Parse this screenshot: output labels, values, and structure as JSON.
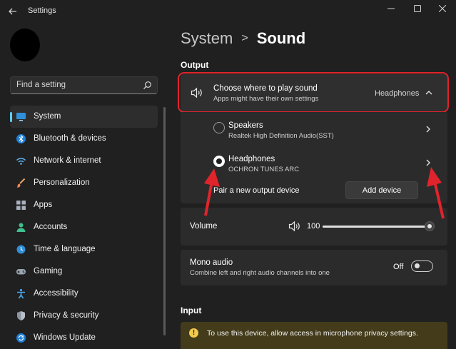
{
  "window": {
    "app_title": "Settings",
    "back_icon": "back-arrow-icon",
    "controls": [
      "minimize-icon",
      "maximize-icon",
      "close-icon"
    ]
  },
  "search": {
    "placeholder": "Find a setting",
    "icon": "search-icon"
  },
  "sidebar": {
    "items": [
      {
        "label": "System",
        "icon": "monitor-icon",
        "active": true
      },
      {
        "label": "Bluetooth & devices",
        "icon": "bluetooth-icon"
      },
      {
        "label": "Network & internet",
        "icon": "wifi-icon"
      },
      {
        "label": "Personalization",
        "icon": "brush-icon"
      },
      {
        "label": "Apps",
        "icon": "apps-grid-icon"
      },
      {
        "label": "Accounts",
        "icon": "person-icon"
      },
      {
        "label": "Time & language",
        "icon": "globe-clock-icon"
      },
      {
        "label": "Gaming",
        "icon": "gamepad-icon"
      },
      {
        "label": "Accessibility",
        "icon": "accessibility-icon"
      },
      {
        "label": "Privacy & security",
        "icon": "shield-icon"
      },
      {
        "label": "Windows Update",
        "icon": "update-icon"
      }
    ]
  },
  "breadcrumb": {
    "parent": "System",
    "separator": ">",
    "current": "Sound"
  },
  "output": {
    "section_label": "Output",
    "choose": {
      "title": "Choose where to play sound",
      "subtitle": "Apps might have their own settings",
      "value": "Headphones",
      "icon": "speaker-icon"
    },
    "devices": [
      {
        "name": "Speakers",
        "sub": "Realtek High Definition Audio(SST)",
        "selected": false
      },
      {
        "name": "Headphones",
        "sub": "OCHRON TUNES ARC",
        "selected": true
      }
    ],
    "pair_label": "Pair a new output device",
    "add_device_label": "Add device",
    "volume": {
      "label": "Volume",
      "value": "100",
      "level": 1.0,
      "icon": "speaker-icon"
    },
    "mono": {
      "title": "Mono audio",
      "subtitle": "Combine left and right audio channels into one",
      "state": "Off"
    }
  },
  "input": {
    "section_label": "Input",
    "notice": "To use this device, allow access in microphone privacy settings.",
    "notice_icon": "warning-icon"
  },
  "colors": {
    "accent": "#60cdff",
    "annotation_red": "#e0242c",
    "warning_bg": "#433b1a",
    "warning_icon": "#f2c94c"
  }
}
